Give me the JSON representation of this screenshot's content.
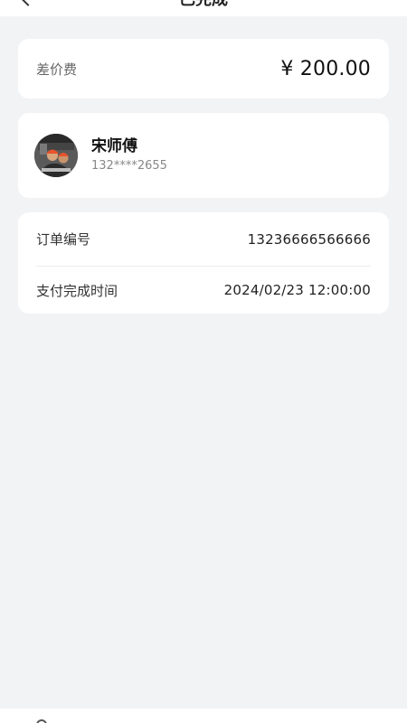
{
  "header": {
    "title": "已完成",
    "back_icon": "chevron-left-icon"
  },
  "price": {
    "label": "差价费",
    "amount": "¥ 200.00"
  },
  "worker": {
    "name": "宋师傅",
    "phone": "132****2655",
    "avatar_icon": "worker-avatar"
  },
  "order": {
    "rows": [
      {
        "label": "订单编号",
        "value": "13236666566666"
      },
      {
        "label": "支付完成时间",
        "value": "2024/02/23  12:00:00"
      }
    ]
  },
  "bottom_bar": {
    "icon": "circle-icon"
  }
}
